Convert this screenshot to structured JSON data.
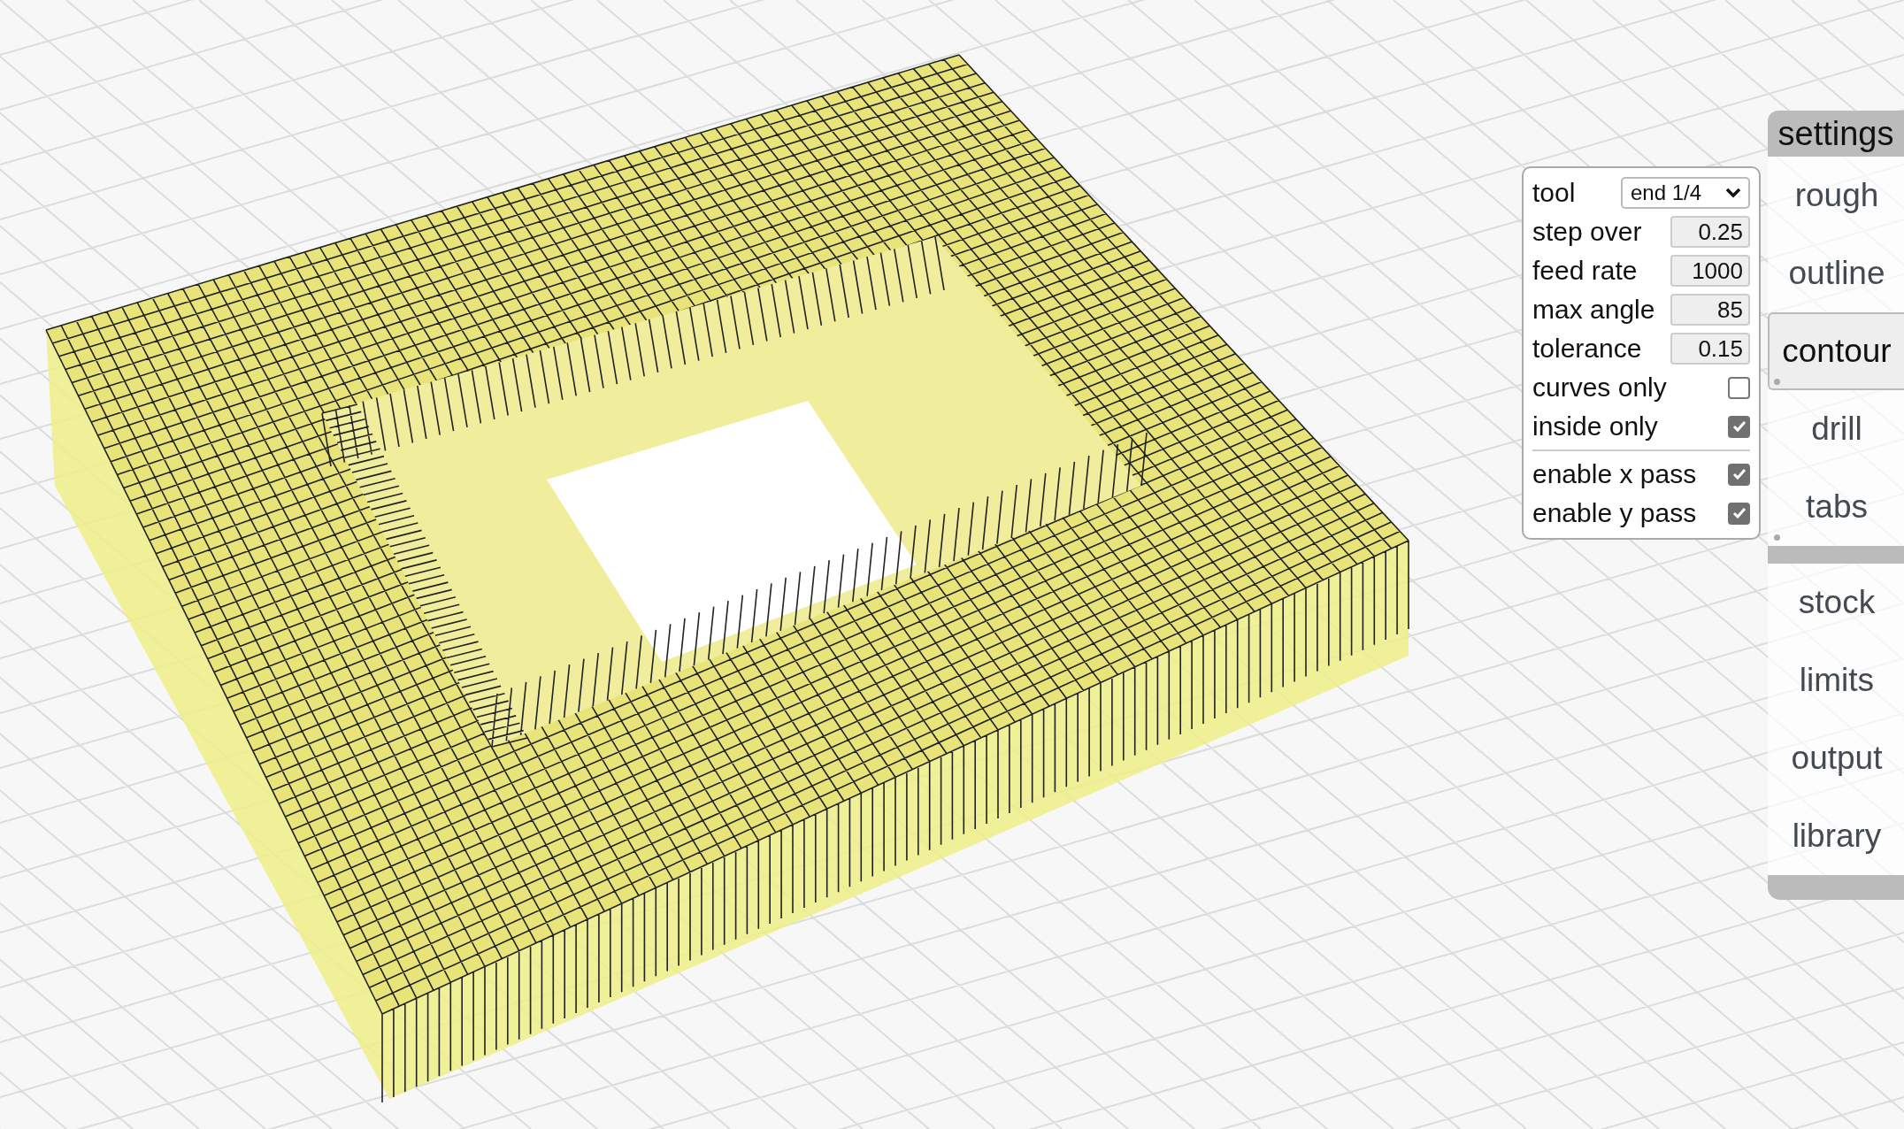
{
  "tool_panel": {
    "sections": [
      {
        "fields": [
          {
            "kind": "select",
            "label": "tool",
            "value": "end 1/4"
          },
          {
            "kind": "number",
            "label": "step over",
            "value": "0.25"
          },
          {
            "kind": "number",
            "label": "feed rate",
            "value": "1000"
          },
          {
            "kind": "number",
            "label": "max angle",
            "value": "85"
          },
          {
            "kind": "number",
            "label": "tolerance",
            "value": "0.15"
          },
          {
            "kind": "checkbox",
            "label": "curves only",
            "checked": false
          },
          {
            "kind": "checkbox",
            "label": "inside only",
            "checked": true
          }
        ]
      },
      {
        "fields": [
          {
            "kind": "checkbox",
            "label": "enable x pass",
            "checked": true
          },
          {
            "kind": "checkbox",
            "label": "enable y pass",
            "checked": true
          }
        ]
      }
    ]
  },
  "menu": {
    "title": "settings",
    "groups": [
      {
        "items": [
          {
            "label": "rough",
            "selected": false,
            "flagged": false
          },
          {
            "label": "outline",
            "selected": false,
            "flagged": false
          },
          {
            "label": "contour",
            "selected": true,
            "flagged": true
          },
          {
            "label": "drill",
            "selected": false,
            "flagged": false
          },
          {
            "label": "tabs",
            "selected": false,
            "flagged": true
          }
        ]
      },
      {
        "items": [
          {
            "label": "stock",
            "selected": false,
            "flagged": false
          },
          {
            "label": "limits",
            "selected": false,
            "flagged": false
          },
          {
            "label": "output",
            "selected": false,
            "flagged": false
          },
          {
            "label": "library",
            "selected": false,
            "flagged": false
          }
        ]
      }
    ]
  }
}
